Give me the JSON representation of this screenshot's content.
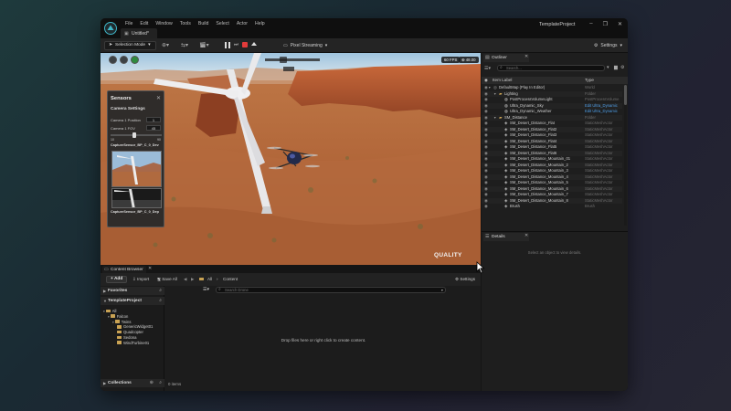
{
  "window": {
    "project_name": "TemplateProject",
    "menu": [
      "File",
      "Edit",
      "Window",
      "Tools",
      "Build",
      "Select",
      "Actor",
      "Help"
    ],
    "doc_tab": "Untitled*",
    "controls": [
      "–",
      "❐",
      "✕"
    ]
  },
  "toolbar": {
    "selection_mode": "Selection Mode",
    "pixel_streaming": "Pixel Streaming",
    "settings": "Settings"
  },
  "viewport": {
    "fps": "60 FPS",
    "speed": "⊕ 48.00",
    "logo": "QUALITY",
    "sensors": {
      "title": "Sensors",
      "section": "Camera Settings",
      "position_label": "Camera 1 Position",
      "position_value": "1",
      "fov_label": "Camera 1 FOV",
      "fov_value": "45",
      "slider_min": "10",
      "slider_max": "90",
      "slider_level": 0.47,
      "capture_top": "CaptureSensor_BP_C_0_Dev",
      "capture_bottom": "CaptureSensor_BP_C_0_Dep"
    }
  },
  "outliner": {
    "tab": "Outliner",
    "search_placeholder": "Search...",
    "col_label": "Item Label",
    "col_type": "Type",
    "rows": [
      {
        "label": "DefaultMap (Play In Editor)",
        "type": "World",
        "indent": 0,
        "icon": "world",
        "link": false
      },
      {
        "label": "Lighting",
        "type": "Folder",
        "indent": 1,
        "icon": "folder",
        "link": false
      },
      {
        "label": "PostProcessVolumeLight",
        "type": "PostProcessVolume",
        "indent": 2,
        "icon": "actor",
        "link": false
      },
      {
        "label": "Ultra_Dynamic_Sky",
        "type": "Edit Ultra_Dynamic",
        "indent": 2,
        "icon": "actor",
        "link": true
      },
      {
        "label": "Ultra_Dynamic_Weather",
        "type": "Edit Ultra_Dynamic",
        "indent": 2,
        "icon": "actor",
        "link": true
      },
      {
        "label": "SM_Distance",
        "type": "Folder",
        "indent": 1,
        "icon": "folder",
        "link": false
      },
      {
        "label": "SM_Desert_Distance_Flat",
        "type": "StaticMeshActor",
        "indent": 2,
        "icon": "mesh",
        "link": false
      },
      {
        "label": "SM_Desert_Distance_Flat2",
        "type": "StaticMeshActor",
        "indent": 2,
        "icon": "mesh",
        "link": false
      },
      {
        "label": "SM_Desert_Distance_Flat3",
        "type": "StaticMeshActor",
        "indent": 2,
        "icon": "mesh",
        "link": false
      },
      {
        "label": "SM_Desert_Distance_Flat4",
        "type": "StaticMeshActor",
        "indent": 2,
        "icon": "mesh",
        "link": false
      },
      {
        "label": "SM_Desert_Distance_Flat5",
        "type": "StaticMeshActor",
        "indent": 2,
        "icon": "mesh",
        "link": false
      },
      {
        "label": "SM_Desert_Distance_Flat6",
        "type": "StaticMeshActor",
        "indent": 2,
        "icon": "mesh",
        "link": false
      },
      {
        "label": "SM_Desert_Distance_Mountain_01",
        "type": "StaticMeshActor",
        "indent": 2,
        "icon": "mesh",
        "link": false
      },
      {
        "label": "SM_Desert_Distance_Mountain_2",
        "type": "StaticMeshActor",
        "indent": 2,
        "icon": "mesh",
        "link": false
      },
      {
        "label": "SM_Desert_Distance_Mountain_3",
        "type": "StaticMeshActor",
        "indent": 2,
        "icon": "mesh",
        "link": false
      },
      {
        "label": "SM_Desert_Distance_Mountain_4",
        "type": "StaticMeshActor",
        "indent": 2,
        "icon": "mesh",
        "link": false
      },
      {
        "label": "SM_Desert_Distance_Mountain_5",
        "type": "StaticMeshActor",
        "indent": 2,
        "icon": "mesh",
        "link": false
      },
      {
        "label": "SM_Desert_Distance_Mountain_6",
        "type": "StaticMeshActor",
        "indent": 2,
        "icon": "mesh",
        "link": false
      },
      {
        "label": "SM_Desert_Distance_Mountain_7",
        "type": "StaticMeshActor",
        "indent": 2,
        "icon": "mesh",
        "link": false
      },
      {
        "label": "SM_Desert_Distance_Mountain_8",
        "type": "StaticMeshActor",
        "indent": 2,
        "icon": "mesh",
        "link": false
      },
      {
        "label": "Brush",
        "type": "Brush",
        "indent": 2,
        "icon": "mesh",
        "link": false
      }
    ],
    "actor_count": "427 actors"
  },
  "details": {
    "tab": "Details",
    "empty_text": "Select an object to view details."
  },
  "content_browser": {
    "tab": "Content Browser",
    "add": "+ Add",
    "import": "Import",
    "save_all": "Save All",
    "path_all": "All",
    "path_content": "Content",
    "settings": "Settings",
    "search_placeholder": "Search Drone",
    "favorites": "Favorites",
    "project": "TemplateProject",
    "collections": "Collections",
    "tree": [
      {
        "label": "All",
        "indent": 0
      },
      {
        "label": "Falcon",
        "indent": 1
      },
      {
        "label": "Twins",
        "indent": 2
      },
      {
        "label": "GenericWidget01",
        "indent": 3
      },
      {
        "label": "Quadcopter",
        "indent": 3
      },
      {
        "label": "Sedona",
        "indent": 3
      },
      {
        "label": "WindTurbine01",
        "indent": 3
      }
    ],
    "empty_message": "Drop files here or right click to create content.",
    "items_count": "0 items"
  },
  "colors": {
    "accent_blue": "#4f9fe8",
    "stop_red": "#e23b3b",
    "folder_gold": "#c9a253"
  }
}
